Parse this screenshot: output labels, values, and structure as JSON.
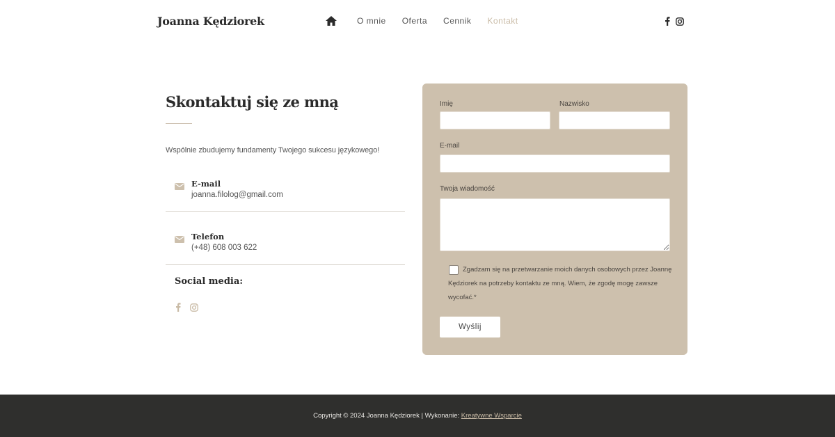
{
  "header": {
    "brand": "Joanna Kędziorek",
    "nav": [
      {
        "label": "O mnie"
      },
      {
        "label": "Oferta"
      },
      {
        "label": "Cennik"
      },
      {
        "label": "Kontakt",
        "active": true
      }
    ],
    "icons": [
      "home-icon",
      "facebook-icon",
      "instagram-icon"
    ]
  },
  "contact": {
    "title": "Skontaktuj się ze mną",
    "intro": "Wspólnie zbudujemy fundamenty Twojego sukcesu językowego!",
    "email_label": "E-mail",
    "email_value": "joanna.filolog@gmail.com",
    "phone_label": "Telefon",
    "phone_value": "(+48) 608 003 622",
    "social_label": "Social media:"
  },
  "form": {
    "first_name_label": "Imię",
    "last_name_label": "Nazwisko",
    "email_label": "E-mail",
    "message_label": "Twoja wiadomość",
    "consent_text": "Zgadzam się na przetwarzanie moich danych osobowych przez Joannę Kędziorek na potrzeby kontaktu ze mną. Wiem, że zgodę mogę zawsze wycofać.*",
    "submit_label": "Wyślij"
  },
  "footer": {
    "copyright": "Copyright © 2024 Joanna Kędziorek | Wykonanie: ",
    "credit": "Kreatywne Wsparcie"
  },
  "colors": {
    "accent": "#cdc0ad",
    "active_nav": "#c9bba6",
    "footer_bg": "#2f2f2d"
  }
}
